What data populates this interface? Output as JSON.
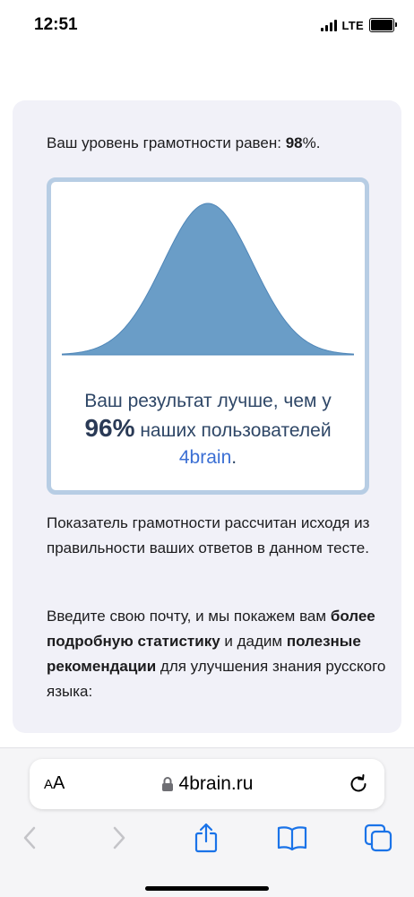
{
  "status": {
    "time": "12:51",
    "network": "LTE"
  },
  "content": {
    "level_prefix": "Ваш уровень грамотности равен: ",
    "level_value": "98",
    "level_suffix": "%.",
    "result_line1": "Ваш результат лучше, чем у",
    "result_percent": "96%",
    "result_line2_rest": " наших пользователей",
    "result_brand": "4brain",
    "result_end": ".",
    "para1": "Показатель грамотности рассчитан исходя из правильности ваших ответов в данном тесте.",
    "para2_a": "Введите свою почту, и мы покажем вам ",
    "para2_b": "более подробную статистику",
    "para2_c": " и дадим ",
    "para2_d": "полезные рекомендации",
    "para2_e": " для улучшения знания русского языка:"
  },
  "browser": {
    "text_size_label_small": "A",
    "text_size_label_large": "A",
    "url": "4brain.ru",
    "icons": [
      "lock-icon",
      "reload-icon",
      "back-icon",
      "forward-icon",
      "share-icon",
      "bookmarks-icon",
      "tabs-icon"
    ]
  },
  "colors": {
    "accent": "#3b6fd4",
    "curve": "#6a9dc7",
    "card_bg": "#f1f1f8",
    "box_border": "#b7cde4"
  }
}
